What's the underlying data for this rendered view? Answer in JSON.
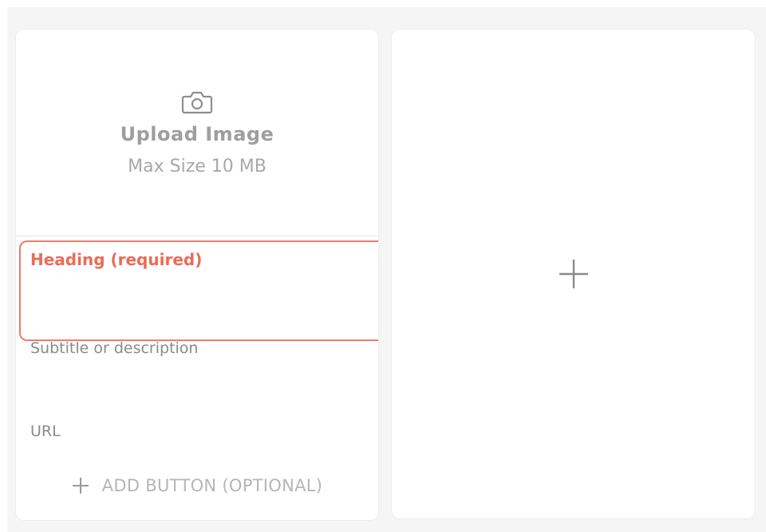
{
  "upload": {
    "title": "Upload Image",
    "subtitle": "Max Size 10 MB",
    "icon": "camera-icon"
  },
  "fields": {
    "heading_placeholder": "Heading (required)",
    "subtitle_placeholder": "Subtitle or description",
    "url_placeholder": "URL"
  },
  "add_button": {
    "label": "ADD BUTTON (OPTIONAL)",
    "icon": "plus-icon"
  },
  "add_card": {
    "icon": "plus-icon"
  },
  "colors": {
    "error_accent": "#ed6a57",
    "background": "#f5f5f5",
    "card": "#ffffff"
  }
}
